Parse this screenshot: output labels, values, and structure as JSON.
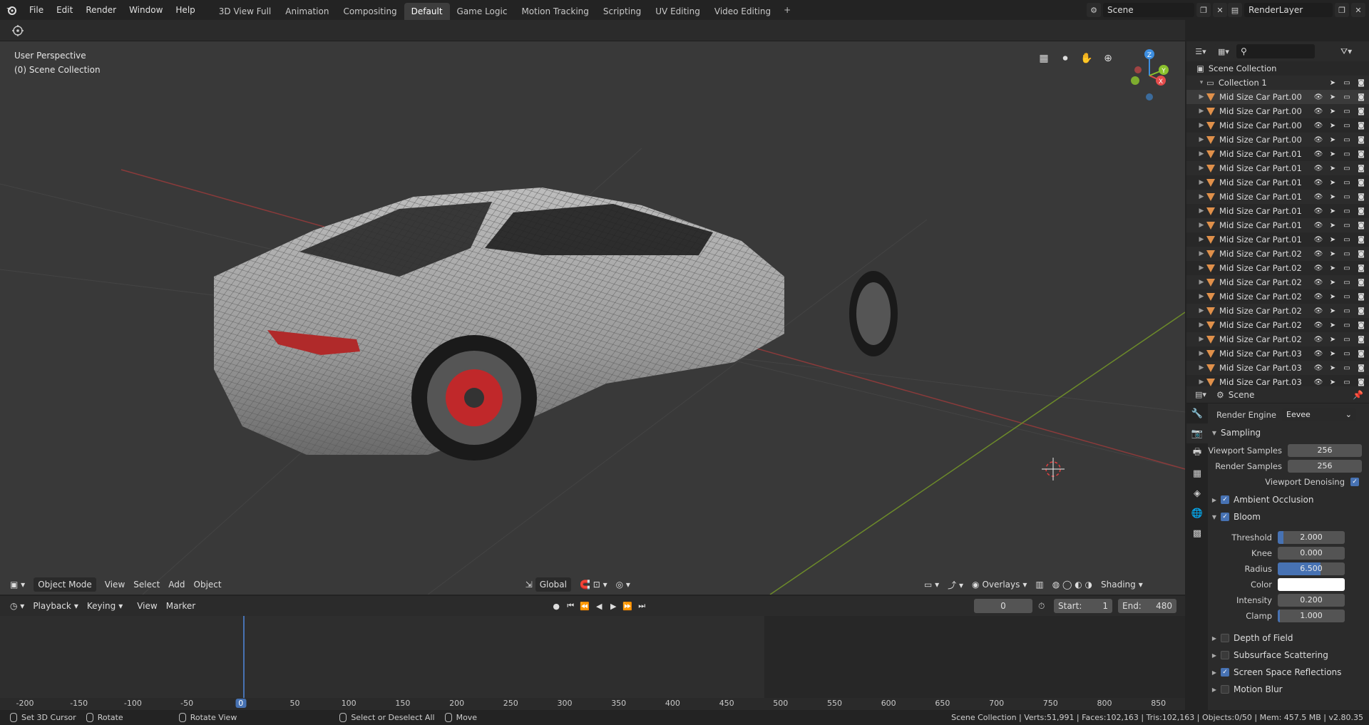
{
  "topbar": {
    "menus": [
      "File",
      "Edit",
      "Render",
      "Window",
      "Help"
    ],
    "workspaces": [
      "3D View Full",
      "Animation",
      "Compositing",
      "Default",
      "Game Logic",
      "Motion Tracking",
      "Scripting",
      "UV Editing",
      "Video Editing"
    ],
    "active_workspace": "Default",
    "add_workspace": "+",
    "scene_name": "Scene",
    "view_layer": "RenderLayer"
  },
  "viewport": {
    "view_name": "User Perspective",
    "collection_label": "(0) Scene Collection",
    "header": {
      "mode": "Object Mode",
      "menus": [
        "View",
        "Select",
        "Add",
        "Object"
      ],
      "transform_orientation": "Global",
      "overlays": "Overlays",
      "shading": "Shading"
    },
    "gizmo": {
      "x": "X",
      "y": "Y",
      "z": "Z"
    }
  },
  "timeline": {
    "menus": [
      "Playback",
      "Keying",
      "View",
      "Marker"
    ],
    "current_frame": "0",
    "start_label": "Start:",
    "start": "1",
    "end_label": "End:",
    "end": "480",
    "ruler": [
      "-200",
      "-150",
      "-100",
      "-50",
      "0",
      "50",
      "100",
      "150",
      "200",
      "250",
      "300",
      "350",
      "400",
      "450",
      "500",
      "550",
      "600",
      "650",
      "700",
      "750",
      "800",
      "850"
    ]
  },
  "outliner": {
    "root": "Scene Collection",
    "collection": "Collection 1",
    "items": [
      "Mid Size Car Part.00",
      "Mid Size Car Part.00",
      "Mid Size Car Part.00",
      "Mid Size Car Part.00",
      "Mid Size Car Part.01",
      "Mid Size Car Part.01",
      "Mid Size Car Part.01",
      "Mid Size Car Part.01",
      "Mid Size Car Part.01",
      "Mid Size Car Part.01",
      "Mid Size Car Part.01",
      "Mid Size Car Part.02",
      "Mid Size Car Part.02",
      "Mid Size Car Part.02",
      "Mid Size Car Part.02",
      "Mid Size Car Part.02",
      "Mid Size Car Part.02",
      "Mid Size Car Part.02",
      "Mid Size Car Part.03",
      "Mid Size Car Part.03",
      "Mid Size Car Part.03"
    ]
  },
  "properties": {
    "context": "Scene",
    "render_engine_label": "Render Engine",
    "render_engine": "Eevee",
    "sampling": {
      "title": "Sampling",
      "viewport_samples_label": "Viewport Samples",
      "viewport_samples": "256",
      "render_samples_label": "Render Samples",
      "render_samples": "256",
      "denoising_label": "Viewport Denoising"
    },
    "ambient_occlusion": "Ambient Occlusion",
    "bloom": {
      "title": "Bloom",
      "threshold_label": "Threshold",
      "threshold": "2.000",
      "threshold_fill": 0.08,
      "knee_label": "Knee",
      "knee": "0.000",
      "knee_fill": 0.0,
      "radius_label": "Radius",
      "radius": "6.500",
      "radius_fill": 0.64,
      "color_label": "Color",
      "color": "#ffffff",
      "intensity_label": "Intensity",
      "intensity": "0.200",
      "intensity_fill": 0.0,
      "clamp_label": "Clamp",
      "clamp": "1.000",
      "clamp_fill": 0.03
    },
    "panels": [
      {
        "label": "Depth of Field",
        "checked": false
      },
      {
        "label": "Subsurface Scattering",
        "checked": false
      },
      {
        "label": "Screen Space Reflections",
        "checked": true
      },
      {
        "label": "Motion Blur",
        "checked": false
      }
    ]
  },
  "statusbar": {
    "set_cursor": "Set 3D Cursor",
    "rotate": "Rotate",
    "rotate_view": "Rotate View",
    "select": "Select or Deselect All",
    "move": "Move",
    "stats": "Scene Collection | Verts:51,991 | Faces:102,163 | Tris:102,163 | Objects:0/50 | Mem: 457.5 MB | v2.80.35"
  },
  "colors": {
    "accent": "#4772b3",
    "mesh_icon": "#e0904a",
    "x_axis": "#e44b4b",
    "y_axis": "#8ac12d",
    "z_axis": "#3d8ee0"
  }
}
